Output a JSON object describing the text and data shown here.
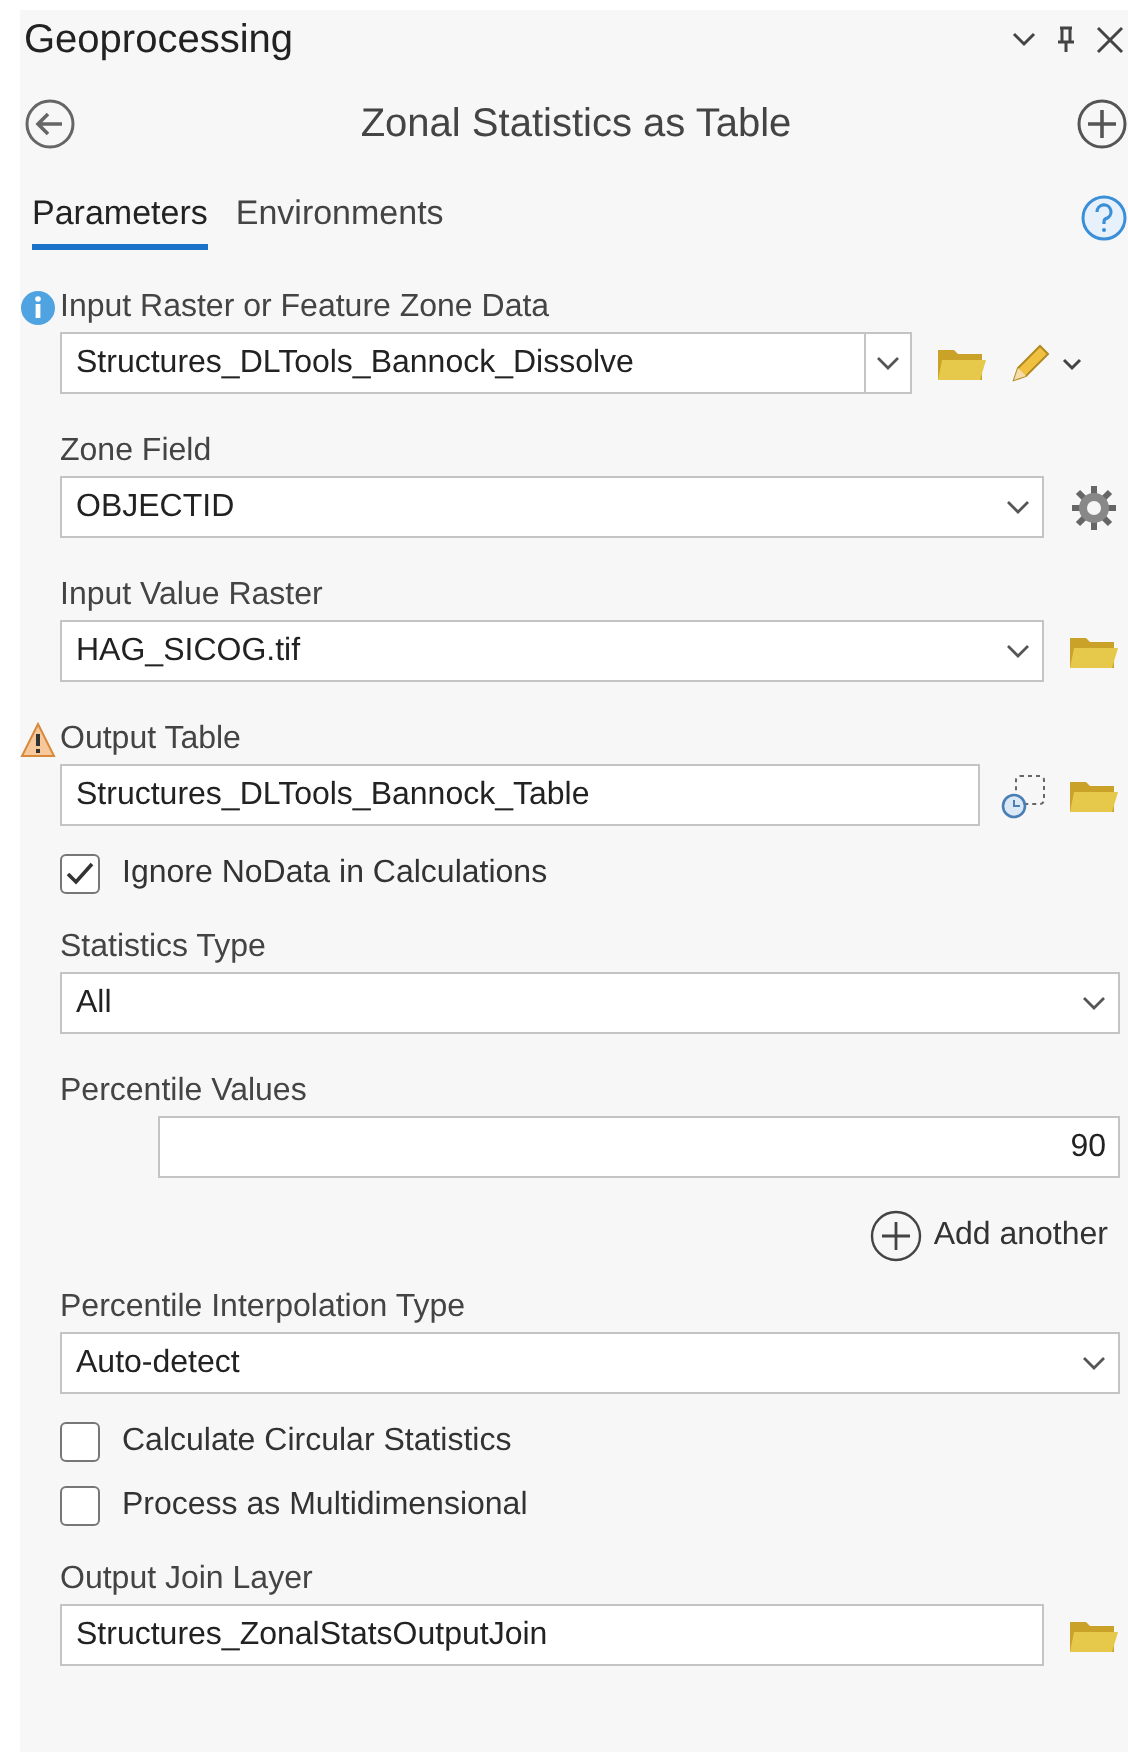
{
  "panel": {
    "title": "Geoprocessing"
  },
  "tool": {
    "title": "Zonal Statistics as Table"
  },
  "tabs": [
    {
      "label": "Parameters",
      "selected": true
    },
    {
      "label": "Environments",
      "selected": false
    }
  ],
  "parameters": [
    {
      "kind": "combo",
      "label": "Input Raster or Feature Zone Data",
      "info": true,
      "value": "Structures_DLTools_Bannock_Dissolve",
      "browse": true,
      "edit_menu": true
    },
    {
      "kind": "dropdown",
      "label": "Zone Field",
      "value": "OBJECTID",
      "field_settings": true
    },
    {
      "kind": "dropdown",
      "label": "Input Value Raster",
      "value": "HAG_SICOG.tif",
      "browse": true
    },
    {
      "kind": "text",
      "label": "Output Table",
      "warning": true,
      "value": "Structures_DLTools_Bannock_Table",
      "dataset_picker": true,
      "browse": true
    },
    {
      "kind": "checkbox",
      "label": "Ignore NoData in Calculations",
      "checked": true
    },
    {
      "kind": "dropdown",
      "label": "Statistics Type",
      "value": "All"
    },
    {
      "kind": "values",
      "label": "Percentile Values",
      "value": "90",
      "add_label": "Add another"
    },
    {
      "kind": "dropdown",
      "label": "Percentile Interpolation Type",
      "value": "Auto-detect"
    },
    {
      "kind": "checkbox",
      "label": "Calculate Circular Statistics",
      "checked": false
    },
    {
      "kind": "checkbox",
      "label": "Process as Multidimensional",
      "checked": false
    },
    {
      "kind": "text",
      "label": "Output Join Layer",
      "value": "Structures_ZonalStatsOutputJoin",
      "browse": true
    }
  ]
}
